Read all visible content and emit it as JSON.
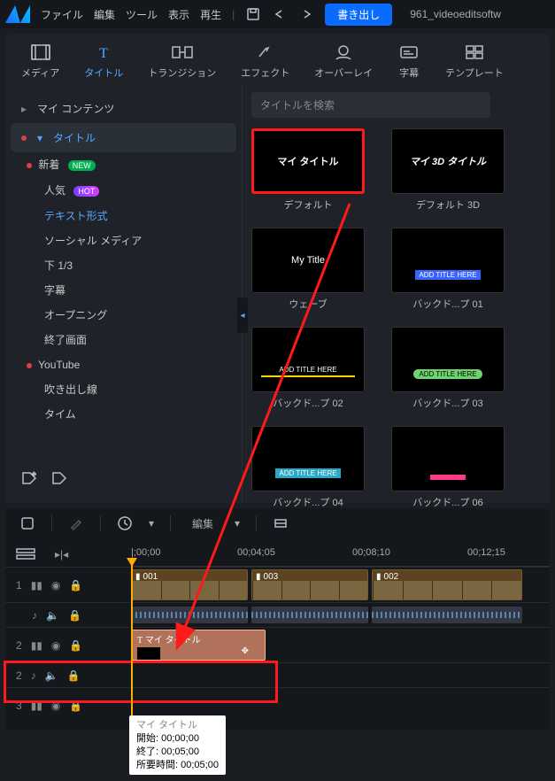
{
  "menu": {
    "file": "ファイル",
    "edit": "編集",
    "tool": "ツール",
    "view": "表示",
    "play": "再生"
  },
  "export_label": "書き出し",
  "project_name": "961_videoeditsoftw",
  "rooms": {
    "media": "メディア",
    "title": "タイトル",
    "transition": "トランジション",
    "effect": "エフェクト",
    "overlay": "オーバーレイ",
    "subtitle": "字幕",
    "template": "テンプレート"
  },
  "sidebar": {
    "my_contents": "マイ コンテンツ",
    "title": "タイトル",
    "subs": {
      "new": "新着",
      "popular": "人気",
      "text_style": "テキスト形式",
      "social": "ソーシャル メディア",
      "lower3": "下 1/3",
      "sub": "字幕",
      "opening": "オープニング",
      "ending": "終了画面",
      "youtube": "YouTube",
      "callout": "吹き出し線",
      "time": "タイム"
    },
    "badge_new": "NEW",
    "badge_hot": "HOT"
  },
  "search_placeholder": "タイトルを検索",
  "thumbs": {
    "t0": {
      "preview": "マイ タイトル",
      "label": "デフォルト"
    },
    "t1": {
      "preview": "マイ 3D タイトル",
      "label": "デフォルト 3D"
    },
    "t2": {
      "preview": "My Title",
      "label": "ウェーブ"
    },
    "t3": {
      "preview": "ADD TITLE HERE",
      "label": "バックド...プ 01"
    },
    "t4": {
      "preview": "ADD TITLE HERE",
      "label": "バックド...プ 02"
    },
    "t5": {
      "preview": "ADD TITLE HERE",
      "label": "バックド...プ 03"
    },
    "t6": {
      "preview": "ADD TITLE HERE",
      "label": "バックド...プ 04"
    },
    "t7": {
      "preview": "",
      "label": "バックド...プ 06"
    }
  },
  "tl_toolbar": {
    "edit": "編集"
  },
  "ruler": {
    "t0": "|;00;00",
    "t1": "00;04;05",
    "t2": "00;08;10",
    "t3": "00;12;15"
  },
  "clips": {
    "c1": "001",
    "c2": "003",
    "c3": "002",
    "title_clip": "マイ タイトル"
  },
  "tooltip": {
    "l1": "マイ タイトル",
    "l2": "開始: 00;00;00",
    "l3": "終了: 00;05;00",
    "l4": "所要時間: 00;05;00"
  },
  "tracknums": {
    "1": "1",
    "2": "2",
    "2b": "2",
    "3": "3"
  }
}
